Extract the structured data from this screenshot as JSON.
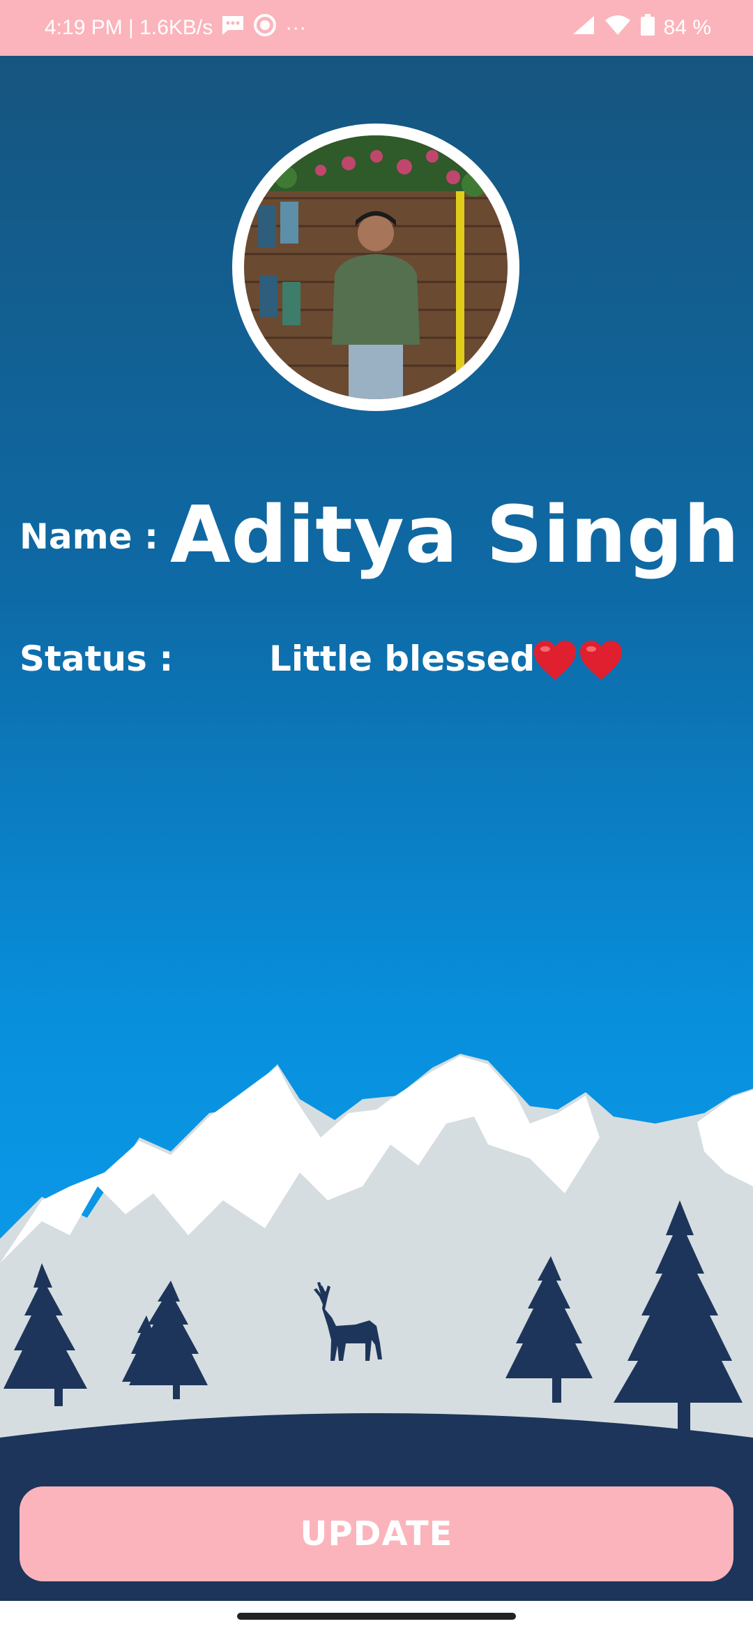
{
  "status_bar": {
    "time_speed": "4:19 PM | 1.6KB/s",
    "more": "···",
    "battery": "84 %",
    "icons": [
      "message-icon",
      "record-icon",
      "signal-icon",
      "wifi-icon",
      "battery-icon"
    ]
  },
  "profile": {
    "avatar": "profile-photo",
    "name_label": "Name :",
    "name_value": "Aditya Singh",
    "status_label": "Status :",
    "status_value": "Little blessed",
    "status_emoji": [
      "heart-icon",
      "heart-icon"
    ]
  },
  "actions": {
    "update_label": "UPDATE"
  },
  "colors": {
    "status_bar": "#fbb4bb",
    "gradient_top": "#16557f",
    "gradient_bottom": "#0a97e6",
    "button": "#fbb4bb",
    "hill": "#1d355a",
    "heart": "#e0202e"
  }
}
